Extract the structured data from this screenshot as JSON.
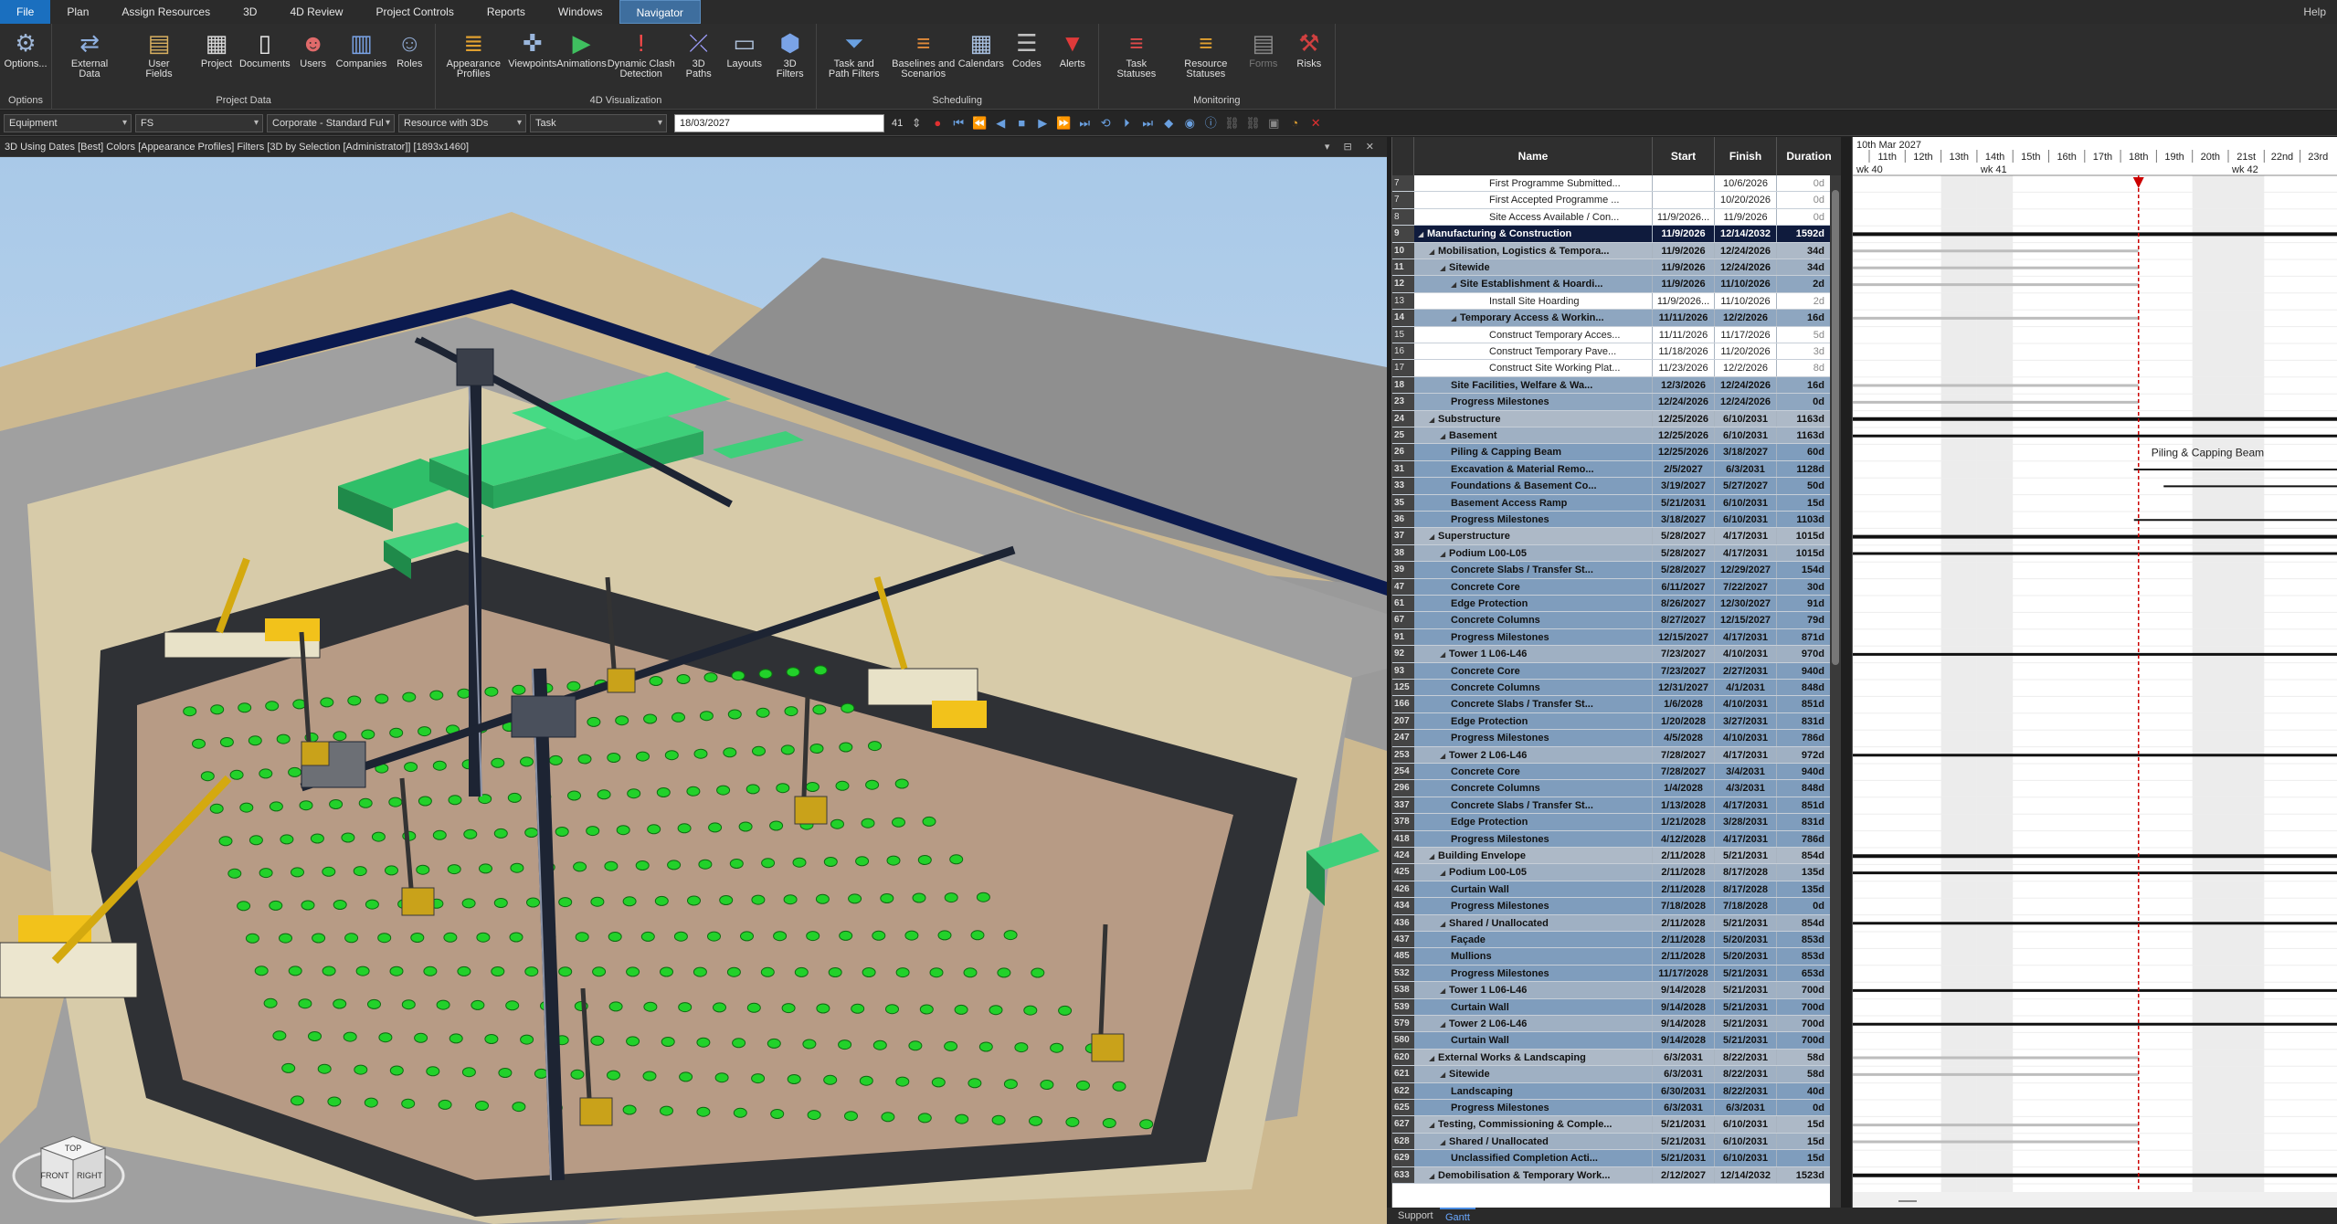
{
  "menu": {
    "tabs": [
      "File",
      "Plan",
      "Assign Resources",
      "3D",
      "4D Review",
      "Project Controls",
      "Reports",
      "Windows",
      "Navigator"
    ],
    "active": "Navigator",
    "help": "Help"
  },
  "ribbon": {
    "groups": [
      {
        "label": "Options",
        "buttons": [
          {
            "label": "Options...",
            "icon": "gear-icon"
          }
        ]
      },
      {
        "label": "Project Data",
        "buttons": [
          {
            "label": "External\nData",
            "icon": "external-data-icon"
          },
          {
            "label": "User\nFields",
            "icon": "user-fields-icon"
          },
          {
            "label": "Project",
            "icon": "project-icon"
          },
          {
            "label": "Documents",
            "icon": "documents-icon"
          },
          {
            "label": "Users",
            "icon": "users-icon"
          },
          {
            "label": "Companies",
            "icon": "companies-icon"
          },
          {
            "label": "Roles",
            "icon": "roles-icon"
          }
        ]
      },
      {
        "label": "4D Visualization",
        "buttons": [
          {
            "label": "Appearance\nProfiles",
            "icon": "appearance-profiles-icon"
          },
          {
            "label": "Viewpoints",
            "icon": "viewpoints-icon"
          },
          {
            "label": "Animations",
            "icon": "animations-icon"
          },
          {
            "label": "Dynamic Clash\nDetection",
            "icon": "clash-detection-icon"
          },
          {
            "label": "3D\nPaths",
            "icon": "paths-icon"
          },
          {
            "label": "Layouts",
            "icon": "layouts-icon"
          },
          {
            "label": "3D\nFilters",
            "icon": "filters-3d-icon"
          }
        ]
      },
      {
        "label": "Scheduling",
        "buttons": [
          {
            "label": "Task and\nPath Filters",
            "icon": "filter-icon"
          },
          {
            "label": "Baselines and\nScenarios",
            "icon": "baselines-icon"
          },
          {
            "label": "Calendars",
            "icon": "calendar-icon"
          },
          {
            "label": "Codes",
            "icon": "codes-icon"
          },
          {
            "label": "Alerts",
            "icon": "alert-icon"
          }
        ]
      },
      {
        "label": "Monitoring",
        "buttons": [
          {
            "label": "Task\nStatuses",
            "icon": "task-statuses-icon"
          },
          {
            "label": "Resource\nStatuses",
            "icon": "resource-statuses-icon"
          },
          {
            "label": "Forms",
            "icon": "forms-icon",
            "disabled": true
          },
          {
            "label": "Risks",
            "icon": "risks-icon"
          }
        ]
      }
    ]
  },
  "toolbar": {
    "dropdowns": [
      "Equipment",
      "FS",
      "Corporate - Standard Ful",
      "Resource with 3Ds",
      "Task"
    ],
    "date": "18/03/2027",
    "step": "41"
  },
  "viewport": {
    "title": "3D Using Dates [Best] Colors [Appearance Profiles] Filters [3D by Selection [Administrator]]  [1893x1460]",
    "cube_top": "TOP",
    "cube_front": "FRONT",
    "cube_right": "RIGHT"
  },
  "grid": {
    "headers": {
      "name": "Name",
      "start": "Start",
      "finish": "Finish",
      "duration": "Duration"
    },
    "rows": [
      {
        "id": "7",
        "name": "First Programme Submitted...",
        "start": "",
        "finish": "10/6/2026",
        "duration": "0d",
        "level": "white",
        "indent": 4
      },
      {
        "id": "7",
        "name": "First Accepted Programme ...",
        "start": "",
        "finish": "10/20/2026",
        "duration": "0d",
        "level": "white",
        "indent": 4
      },
      {
        "id": "8",
        "name": "Site Access Available / Con...",
        "start": "11/9/2026...",
        "finish": "11/9/2026",
        "duration": "0d",
        "level": "white",
        "indent": 4
      },
      {
        "id": "9",
        "name": "Manufacturing & Construction",
        "start": "11/9/2026",
        "finish": "12/14/2032",
        "duration": "1592d",
        "level": "l0",
        "indent": 0,
        "exp": true
      },
      {
        "id": "10",
        "name": "Mobilisation, Logistics & Tempora...",
        "start": "11/9/2026",
        "finish": "12/24/2026",
        "duration": "34d",
        "level": "l1",
        "indent": 1,
        "exp": true
      },
      {
        "id": "11",
        "name": "Sitewide",
        "start": "11/9/2026",
        "finish": "12/24/2026",
        "duration": "34d",
        "level": "l2",
        "indent": 2,
        "exp": true
      },
      {
        "id": "12",
        "name": "Site Establishment & Hoardi...",
        "start": "11/9/2026",
        "finish": "11/10/2026",
        "duration": "2d",
        "level": "l3",
        "indent": 3,
        "exp": true
      },
      {
        "id": "13",
        "name": "Install Site Hoarding",
        "start": "11/9/2026...",
        "finish": "11/10/2026",
        "duration": "2d",
        "level": "white",
        "indent": 4
      },
      {
        "id": "14",
        "name": "Temporary Access & Workin...",
        "start": "11/11/2026",
        "finish": "12/2/2026",
        "duration": "16d",
        "level": "l3",
        "indent": 3,
        "exp": true
      },
      {
        "id": "15",
        "name": "Construct Temporary Acces...",
        "start": "11/11/2026",
        "finish": "11/17/2026",
        "duration": "5d",
        "level": "white",
        "indent": 4
      },
      {
        "id": "16",
        "name": "Construct Temporary Pave...",
        "start": "11/18/2026",
        "finish": "11/20/2026",
        "duration": "3d",
        "level": "white",
        "indent": 4
      },
      {
        "id": "17",
        "name": "Construct Site Working Plat...",
        "start": "11/23/2026",
        "finish": "12/2/2026",
        "duration": "8d",
        "level": "white",
        "indent": 4
      },
      {
        "id": "18",
        "name": "Site Facilities, Welfare & Wa...",
        "start": "12/3/2026",
        "finish": "12/24/2026",
        "duration": "16d",
        "level": "l3",
        "indent": 3
      },
      {
        "id": "23",
        "name": "Progress Milestones",
        "start": "12/24/2026",
        "finish": "12/24/2026",
        "duration": "0d",
        "level": "l3",
        "indent": 3
      },
      {
        "id": "24",
        "name": "Substructure",
        "start": "12/25/2026",
        "finish": "6/10/2031",
        "duration": "1163d",
        "level": "l1",
        "indent": 1,
        "exp": true
      },
      {
        "id": "25",
        "name": "Basement",
        "start": "12/25/2026",
        "finish": "6/10/2031",
        "duration": "1163d",
        "level": "l2",
        "indent": 2,
        "exp": true
      },
      {
        "id": "26",
        "name": "Piling & Capping Beam",
        "start": "12/25/2026",
        "finish": "3/18/2027",
        "duration": "60d",
        "level": "l4",
        "indent": 3
      },
      {
        "id": "31",
        "name": "Excavation & Material Remo...",
        "start": "2/5/2027",
        "finish": "6/3/2031",
        "duration": "1128d",
        "level": "l4",
        "indent": 3
      },
      {
        "id": "33",
        "name": "Foundations & Basement Co...",
        "start": "3/19/2027",
        "finish": "5/27/2027",
        "duration": "50d",
        "level": "l4",
        "indent": 3
      },
      {
        "id": "35",
        "name": "Basement Access Ramp",
        "start": "5/21/2031",
        "finish": "6/10/2031",
        "duration": "15d",
        "level": "l4",
        "indent": 3
      },
      {
        "id": "36",
        "name": "Progress Milestones",
        "start": "3/18/2027",
        "finish": "6/10/2031",
        "duration": "1103d",
        "level": "l4",
        "indent": 3
      },
      {
        "id": "37",
        "name": "Superstructure",
        "start": "5/28/2027",
        "finish": "4/17/2031",
        "duration": "1015d",
        "level": "l1",
        "indent": 1,
        "exp": true
      },
      {
        "id": "38",
        "name": "Podium L00-L05",
        "start": "5/28/2027",
        "finish": "4/17/2031",
        "duration": "1015d",
        "level": "l2",
        "indent": 2,
        "exp": true
      },
      {
        "id": "39",
        "name": "Concrete Slabs / Transfer St...",
        "start": "5/28/2027",
        "finish": "12/29/2027",
        "duration": "154d",
        "level": "l4",
        "indent": 3
      },
      {
        "id": "47",
        "name": "Concrete Core",
        "start": "6/11/2027",
        "finish": "7/22/2027",
        "duration": "30d",
        "level": "l4",
        "indent": 3
      },
      {
        "id": "61",
        "name": "Edge Protection",
        "start": "8/26/2027",
        "finish": "12/30/2027",
        "duration": "91d",
        "level": "l4",
        "indent": 3
      },
      {
        "id": "67",
        "name": "Concrete Columns",
        "start": "8/27/2027",
        "finish": "12/15/2027",
        "duration": "79d",
        "level": "l4",
        "indent": 3
      },
      {
        "id": "91",
        "name": "Progress Milestones",
        "start": "12/15/2027",
        "finish": "4/17/2031",
        "duration": "871d",
        "level": "l4",
        "indent": 3
      },
      {
        "id": "92",
        "name": "Tower 1 L06-L46",
        "start": "7/23/2027",
        "finish": "4/10/2031",
        "duration": "970d",
        "level": "l2",
        "indent": 2,
        "exp": true
      },
      {
        "id": "93",
        "name": "Concrete Core",
        "start": "7/23/2027",
        "finish": "2/27/2031",
        "duration": "940d",
        "level": "l4",
        "indent": 3
      },
      {
        "id": "125",
        "name": "Concrete Columns",
        "start": "12/31/2027",
        "finish": "4/1/2031",
        "duration": "848d",
        "level": "l4",
        "indent": 3
      },
      {
        "id": "166",
        "name": "Concrete Slabs / Transfer St...",
        "start": "1/6/2028",
        "finish": "4/10/2031",
        "duration": "851d",
        "level": "l4",
        "indent": 3
      },
      {
        "id": "207",
        "name": "Edge Protection",
        "start": "1/20/2028",
        "finish": "3/27/2031",
        "duration": "831d",
        "level": "l4",
        "indent": 3
      },
      {
        "id": "247",
        "name": "Progress Milestones",
        "start": "4/5/2028",
        "finish": "4/10/2031",
        "duration": "786d",
        "level": "l4",
        "indent": 3
      },
      {
        "id": "253",
        "name": "Tower 2 L06-L46",
        "start": "7/28/2027",
        "finish": "4/17/2031",
        "duration": "972d",
        "level": "l2",
        "indent": 2,
        "exp": true
      },
      {
        "id": "254",
        "name": "Concrete Core",
        "start": "7/28/2027",
        "finish": "3/4/2031",
        "duration": "940d",
        "level": "l4",
        "indent": 3
      },
      {
        "id": "296",
        "name": "Concrete Columns",
        "start": "1/4/2028",
        "finish": "4/3/2031",
        "duration": "848d",
        "level": "l4",
        "indent": 3
      },
      {
        "id": "337",
        "name": "Concrete Slabs / Transfer St...",
        "start": "1/13/2028",
        "finish": "4/17/2031",
        "duration": "851d",
        "level": "l4",
        "indent": 3
      },
      {
        "id": "378",
        "name": "Edge Protection",
        "start": "1/21/2028",
        "finish": "3/28/2031",
        "duration": "831d",
        "level": "l4",
        "indent": 3
      },
      {
        "id": "418",
        "name": "Progress Milestones",
        "start": "4/12/2028",
        "finish": "4/17/2031",
        "duration": "786d",
        "level": "l4",
        "indent": 3
      },
      {
        "id": "424",
        "name": "Building Envelope",
        "start": "2/11/2028",
        "finish": "5/21/2031",
        "duration": "854d",
        "level": "l1",
        "indent": 1,
        "exp": true
      },
      {
        "id": "425",
        "name": "Podium L00-L05",
        "start": "2/11/2028",
        "finish": "8/17/2028",
        "duration": "135d",
        "level": "l2",
        "indent": 2,
        "exp": true
      },
      {
        "id": "426",
        "name": "Curtain Wall",
        "start": "2/11/2028",
        "finish": "8/17/2028",
        "duration": "135d",
        "level": "l4",
        "indent": 3
      },
      {
        "id": "434",
        "name": "Progress Milestones",
        "start": "7/18/2028",
        "finish": "7/18/2028",
        "duration": "0d",
        "level": "l4",
        "indent": 3
      },
      {
        "id": "436",
        "name": "Shared / Unallocated",
        "start": "2/11/2028",
        "finish": "5/21/2031",
        "duration": "854d",
        "level": "l2",
        "indent": 2,
        "exp": true
      },
      {
        "id": "437",
        "name": "Façade",
        "start": "2/11/2028",
        "finish": "5/20/2031",
        "duration": "853d",
        "level": "l4",
        "indent": 3
      },
      {
        "id": "485",
        "name": "Mullions",
        "start": "2/11/2028",
        "finish": "5/20/2031",
        "duration": "853d",
        "level": "l4",
        "indent": 3
      },
      {
        "id": "532",
        "name": "Progress Milestones",
        "start": "11/17/2028",
        "finish": "5/21/2031",
        "duration": "653d",
        "level": "l4",
        "indent": 3
      },
      {
        "id": "538",
        "name": "Tower 1 L06-L46",
        "start": "9/14/2028",
        "finish": "5/21/2031",
        "duration": "700d",
        "level": "l2",
        "indent": 2,
        "exp": true
      },
      {
        "id": "539",
        "name": "Curtain Wall",
        "start": "9/14/2028",
        "finish": "5/21/2031",
        "duration": "700d",
        "level": "l4",
        "indent": 3
      },
      {
        "id": "579",
        "name": "Tower 2 L06-L46",
        "start": "9/14/2028",
        "finish": "5/21/2031",
        "duration": "700d",
        "level": "l2",
        "indent": 2,
        "exp": true
      },
      {
        "id": "580",
        "name": "Curtain Wall",
        "start": "9/14/2028",
        "finish": "5/21/2031",
        "duration": "700d",
        "level": "l4",
        "indent": 3
      },
      {
        "id": "620",
        "name": "External Works & Landscaping",
        "start": "6/3/2031",
        "finish": "8/22/2031",
        "duration": "58d",
        "level": "l1",
        "indent": 1,
        "exp": true
      },
      {
        "id": "621",
        "name": "Sitewide",
        "start": "6/3/2031",
        "finish": "8/22/2031",
        "duration": "58d",
        "level": "l2",
        "indent": 2,
        "exp": true
      },
      {
        "id": "622",
        "name": "Landscaping",
        "start": "6/30/2031",
        "finish": "8/22/2031",
        "duration": "40d",
        "level": "l4",
        "indent": 3
      },
      {
        "id": "625",
        "name": "Progress Milestones",
        "start": "6/3/2031",
        "finish": "6/3/2031",
        "duration": "0d",
        "level": "l4",
        "indent": 3
      },
      {
        "id": "627",
        "name": "Testing, Commissioning & Comple...",
        "start": "5/21/2031",
        "finish": "6/10/2031",
        "duration": "15d",
        "level": "l1",
        "indent": 1,
        "exp": true
      },
      {
        "id": "628",
        "name": "Shared / Unallocated",
        "start": "5/21/2031",
        "finish": "6/10/2031",
        "duration": "15d",
        "level": "l2",
        "indent": 2,
        "exp": true
      },
      {
        "id": "629",
        "name": "Unclassified Completion Acti...",
        "start": "5/21/2031",
        "finish": "6/10/2031",
        "duration": "15d",
        "level": "l4",
        "indent": 3
      },
      {
        "id": "633",
        "name": "Demobilisation & Temporary Work...",
        "start": "2/12/2027",
        "finish": "12/14/2032",
        "duration": "1523d",
        "level": "l1",
        "indent": 1,
        "exp": true
      }
    ]
  },
  "chart": {
    "month_label": "10th Mar 2027",
    "days": [
      "11th",
      "12th",
      "13th",
      "14th",
      "15th",
      "16th",
      "17th",
      "18th",
      "19th",
      "20th",
      "21st",
      "22nd",
      "23rd"
    ],
    "weeks": [
      {
        "label": "wk 40",
        "day": 0
      },
      {
        "label": "wk 41",
        "day": 3
      },
      {
        "label": "wk 42",
        "day": 10
      }
    ],
    "today_day": 7.5,
    "bar_label": "Piling & Capping Beam",
    "bar_label_row": 16
  },
  "bottom_tabs": [
    "Support",
    "Gantt"
  ],
  "active_bottom_tab": "Gantt",
  "colors": {
    "accent": "#1a6fbf",
    "summary": "#0f1b3d",
    "today_line": "#cc0000",
    "crate_green": "#3ed07a",
    "pile_green": "#22d12a"
  }
}
